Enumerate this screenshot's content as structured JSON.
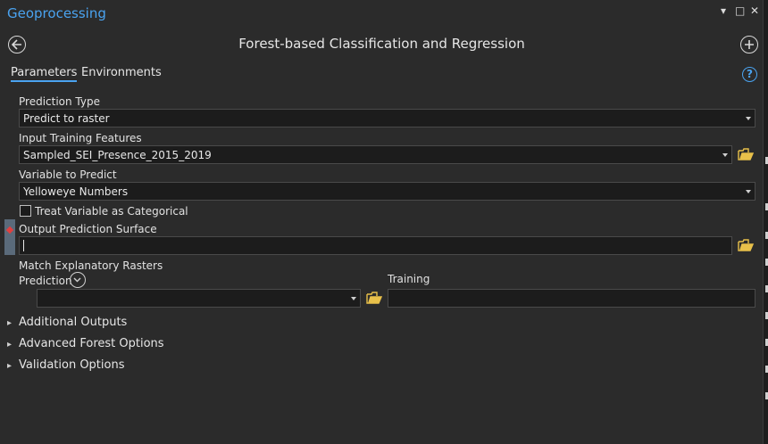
{
  "window": {
    "title": "Geoprocessing",
    "controls": [
      "▾",
      "□",
      "✕"
    ]
  },
  "tool": {
    "title": "Forest-based Classification and Regression"
  },
  "tabs": [
    {
      "label": "Parameters",
      "active": true
    },
    {
      "label": "Environments",
      "active": false
    }
  ],
  "params": {
    "prediction_type": {
      "label": "Prediction Type",
      "value": "Predict to raster"
    },
    "input_training": {
      "label": "Input Training Features",
      "value": "Sampled_SEI_Presence_2015_2019"
    },
    "variable_to_predict": {
      "label": "Variable to Predict",
      "value": "Yelloweye Numbers"
    },
    "treat_categorical": {
      "label": "Treat Variable as Categorical",
      "checked": false
    },
    "output_surface": {
      "label": "Output Prediction Surface",
      "value": "",
      "required": true
    },
    "match_rasters": {
      "label": "Match Explanatory Rasters",
      "prediction_label": "Prediction",
      "training_label": "Training",
      "prediction_value": "",
      "training_value": ""
    }
  },
  "sections": [
    {
      "label": "Additional Outputs"
    },
    {
      "label": "Advanced Forest Options"
    },
    {
      "label": "Validation Options"
    }
  ],
  "colors": {
    "accent": "#4aa3f0",
    "background": "#2b2b2b",
    "field_bg": "#1c1c1c",
    "folder": "#e8c04a",
    "required": "#e04040"
  }
}
